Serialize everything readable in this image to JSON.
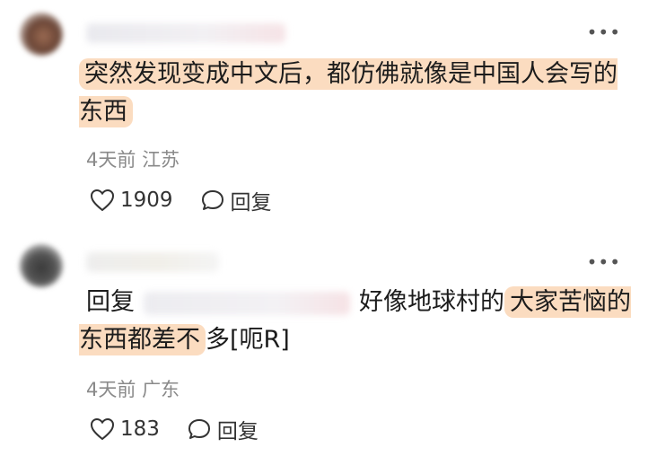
{
  "comments": [
    {
      "text_before": "",
      "text_highlight": "突然发现变成中文后，都仿佛就像是中国人会写的东西",
      "text_after": "",
      "time": "4天前",
      "location": "江苏",
      "likes": "1909",
      "reply_label": "回复"
    },
    {
      "reply_prefix": "回复",
      "text_plain": "好像地球村的",
      "text_highlight": "大家苦恼的东西都差不",
      "text_after": "多[呃R]",
      "time": "4天前",
      "location": "广东",
      "likes": "183",
      "reply_label": "回复"
    }
  ],
  "icons": {
    "more": "more-dots-icon",
    "like": "heart-outline-icon",
    "comment": "comment-bubble-icon"
  },
  "colors": {
    "highlight": "#fbdcc0",
    "meta": "#8a8a8a"
  }
}
